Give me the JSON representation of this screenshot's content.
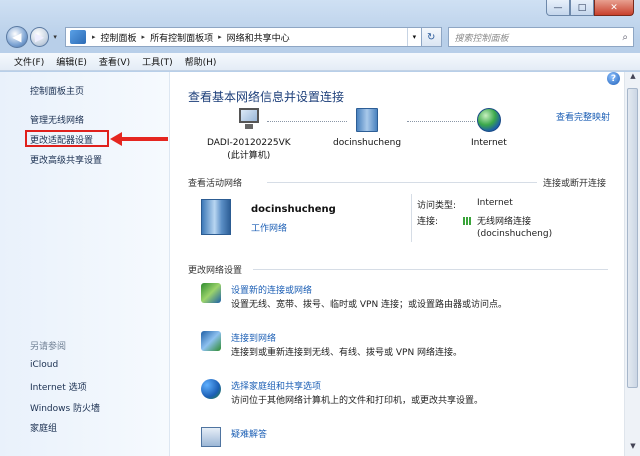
{
  "window": {
    "minimize": "—",
    "maximize": "□",
    "close": "✕"
  },
  "nav": {
    "back": "◀",
    "forward": "▶",
    "history": "▾",
    "breadcrumbs": [
      "控制面板",
      "所有控制面板项",
      "网络和共享中心"
    ],
    "sep": "▸",
    "refresh": "↻",
    "search_placeholder": "搜索控制面板",
    "search_icon": "⌕"
  },
  "menu": [
    "文件(F)",
    "编辑(E)",
    "查看(V)",
    "工具(T)",
    "帮助(H)"
  ],
  "sidebar": {
    "links": [
      "控制面板主页",
      "管理无线网络",
      "更改适配器设置",
      "更改高级共享设置"
    ],
    "see_also_title": "另请参阅",
    "see_also": [
      "iCloud",
      "Internet 选项",
      "Windows 防火墙",
      "家庭组"
    ]
  },
  "main": {
    "help": "?",
    "title": "查看基本网络信息并设置连接",
    "full_map": "查看完整映射",
    "nodes": {
      "computer_name": "DADI-20120225VK",
      "computer_sub": "(此计算机)",
      "network": "docinshucheng",
      "internet": "Internet"
    },
    "active_title": "查看活动网络",
    "connect_disconnect": "连接或断开连接",
    "active": {
      "name": "docinshucheng",
      "type": "工作网络",
      "access_label": "访问类型:",
      "access_value": "Internet",
      "conn_label": "连接:",
      "conn_value": "无线网络连接",
      "conn_value2": "(docinshucheng)"
    },
    "change_title": "更改网络设置",
    "tasks": [
      {
        "title": "设置新的连接或网络",
        "desc": "设置无线、宽带、拨号、临时或 VPN 连接；或设置路由器或访问点。"
      },
      {
        "title": "连接到网络",
        "desc": "连接到或重新连接到无线、有线、拨号或 VPN 网络连接。"
      },
      {
        "title": "选择家庭组和共享选项",
        "desc": "访问位于其他网络计算机上的文件和打印机，或更改共享设置。"
      },
      {
        "title": "疑难解答",
        "desc": ""
      }
    ]
  },
  "colors": {
    "accent": "#1c5fb5",
    "highlight": "#e0201c",
    "heading": "#1d3f7a"
  }
}
